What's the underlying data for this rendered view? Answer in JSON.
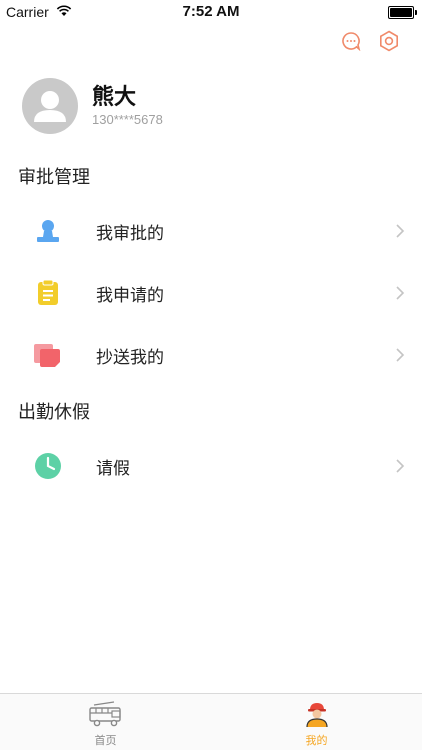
{
  "status_bar": {
    "carrier": "Carrier",
    "time": "7:52 AM"
  },
  "header": {
    "icons": [
      "message-icon",
      "settings-icon"
    ],
    "accent_color": "#f08a6a"
  },
  "profile": {
    "name": "熊大",
    "phone": "130****5678"
  },
  "sections": [
    {
      "title": "审批管理",
      "items": [
        {
          "label": "我审批的",
          "icon": "user-stamp-icon",
          "color": "#5aa6f0"
        },
        {
          "label": "我申请的",
          "icon": "clipboard-icon",
          "color": "#f2cd2b"
        },
        {
          "label": "抄送我的",
          "icon": "copy-icon",
          "color": "#f2646a"
        }
      ]
    },
    {
      "title": "出勤休假",
      "items": [
        {
          "label": "请假",
          "icon": "clock-icon",
          "color": "#5dd1a6"
        }
      ]
    }
  ],
  "tab_bar": {
    "tabs": [
      {
        "label": "首页",
        "icon": "fire-truck-icon",
        "active": false
      },
      {
        "label": "我的",
        "icon": "firefighter-icon",
        "active": true
      }
    ],
    "active_color": "#f5a623",
    "inactive_color": "#888888"
  }
}
